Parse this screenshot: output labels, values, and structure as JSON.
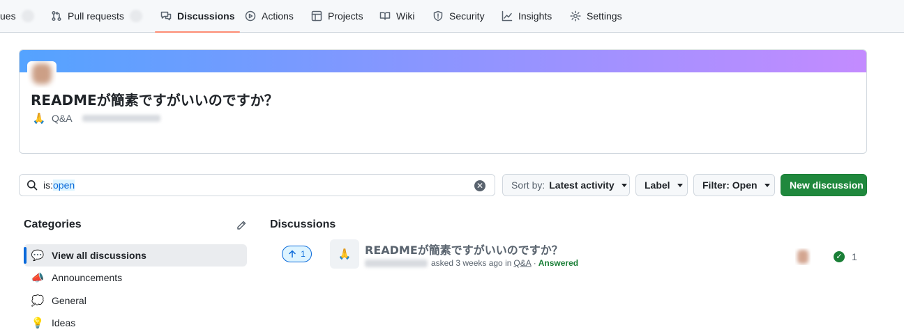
{
  "repo_nav": {
    "tabs": [
      {
        "label": "ues",
        "icon": "issue-icon"
      },
      {
        "label": "Pull requests",
        "icon": "pull-request-icon"
      },
      {
        "label": "Discussions",
        "icon": "discussion-icon",
        "active": true
      },
      {
        "label": "Actions",
        "icon": "play-icon"
      },
      {
        "label": "Projects",
        "icon": "table-icon"
      },
      {
        "label": "Wiki",
        "icon": "book-icon"
      },
      {
        "label": "Security",
        "icon": "shield-icon"
      },
      {
        "label": "Insights",
        "icon": "graph-icon"
      },
      {
        "label": "Settings",
        "icon": "gear-icon"
      }
    ],
    "accent_color": "#fd8c73"
  },
  "banner": {
    "title": "READMEが簡素ですがいいのですか？",
    "category_emoji": "🙏",
    "category_label": "Q&A"
  },
  "search": {
    "prefix": "is:",
    "value": "open"
  },
  "toolbar": {
    "sort_prefix": "Sort by:",
    "sort_value": "Latest activity",
    "label_button": "Label",
    "filter_button": "Filter: Open",
    "new_discussion": "New discussion"
  },
  "sidebar": {
    "title": "Categories",
    "items": [
      {
        "label": "View all discussions",
        "emoji": "💬",
        "active": true
      },
      {
        "label": "Announcements",
        "emoji": "📣"
      },
      {
        "label": "General",
        "emoji": "💭"
      },
      {
        "label": "Ideas",
        "emoji": "💡"
      }
    ]
  },
  "discussions": {
    "title": "Discussions",
    "items": [
      {
        "upvotes": "1",
        "emoji": "🙏",
        "title": "READMEが簡素ですがいいのですか？",
        "asked": "asked 3 weeks ago in",
        "category": "Q&A",
        "separator": "·",
        "status": "Answered",
        "answers": "1"
      }
    ]
  },
  "colors": {
    "primary_button": "#1f883d",
    "link_blue": "#0969da",
    "answered_green": "#1a7f37"
  }
}
